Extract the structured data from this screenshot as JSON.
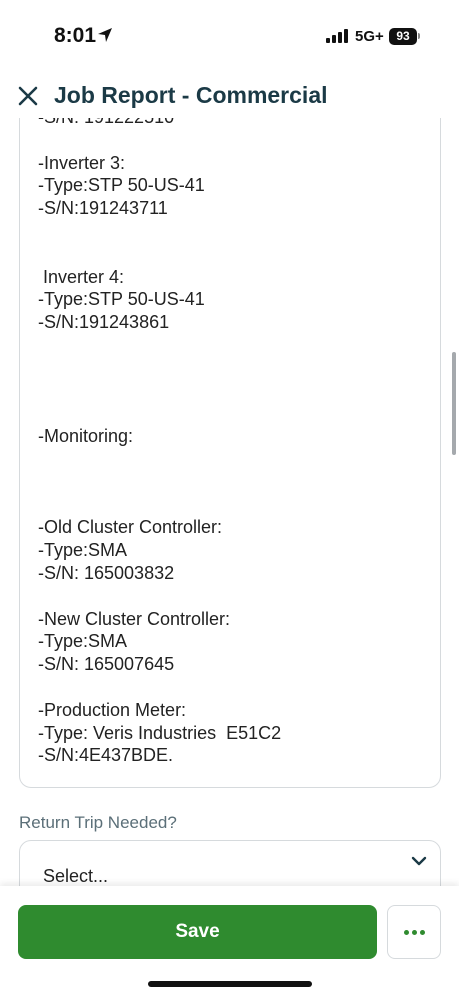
{
  "status_bar": {
    "time": "8:01",
    "network": "5G+",
    "battery": "93"
  },
  "header": {
    "title": "Job Report - Commercial",
    "close_icon": "close-icon"
  },
  "notes": {
    "text": "-S/N: 191222510\n\n-Inverter 3:\n-Type:STP 50-US-41\n-S/N:191243711\n\n\n Inverter 4:\n-Type:STP 50-US-41\n-S/N:191243861\n\n\n\n\n-Monitoring:\n\n\n\n-Old Cluster Controller:\n-Type:SMA\n-S/N: 165003832\n\n-New Cluster Controller:\n-Type:SMA\n-S/N: 165007645\n\n-Production Meter:\n-Type: Veris Industries  E51C2\n-S/N:4E437BDE."
  },
  "return_trip": {
    "label": "Return Trip Needed?",
    "value": "Select..."
  },
  "actions": {
    "save_label": "Save",
    "more_icon": "more-horizontal-icon"
  },
  "colors": {
    "accent": "#2f8b2f",
    "title": "#1b3a46"
  }
}
